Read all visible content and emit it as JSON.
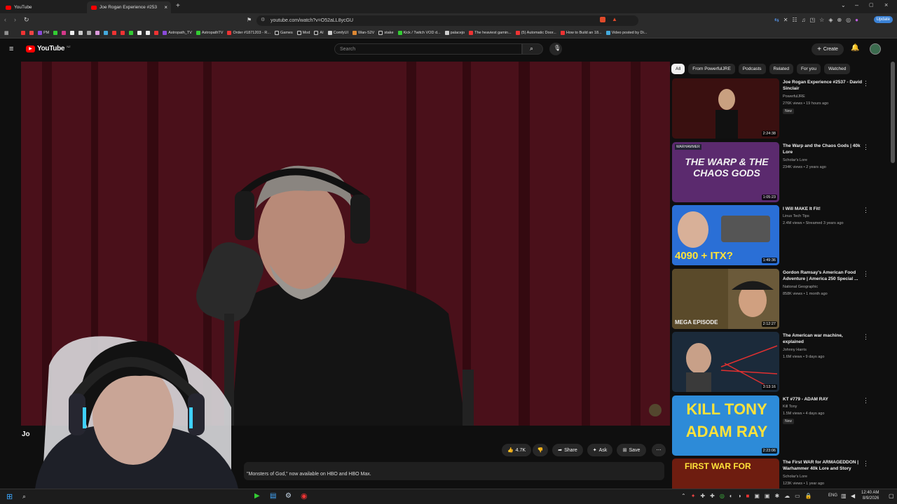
{
  "browser": {
    "tabs": [
      {
        "title": "YouTube"
      },
      {
        "title": "Joe Rogan Experience #253"
      }
    ],
    "url": "youtube.com/watch?v=O52aLL8ycGU",
    "update_label": "Update",
    "bookmarks": [
      "PM",
      "Astropath_TV",
      "AstropathTV",
      "Order #1871203 - R...",
      "Games",
      "Mod",
      "AI",
      "ComfyUI",
      "Wan-S2V",
      "stake",
      "Kick / Twitch VOD d...",
      "palacejo",
      "The heaviest gamin...",
      "(5) Automatic Door...",
      "How to Build an 18...",
      "Video posted by Di..."
    ]
  },
  "youtube": {
    "logo_text": "YouTube",
    "logo_region": "NZ",
    "search_placeholder": "Search",
    "create_label": "Create",
    "chips": [
      "All",
      "From PowerfulJRE",
      "Podcasts",
      "Related",
      "For you",
      "Watched"
    ],
    "actions": {
      "likes": "4.7K",
      "share": "Share",
      "ask": "Ask",
      "save": "Save"
    },
    "video_title_partial": "Jo",
    "description_snippet": "\"Monsters of God,\" now available on HBO and HBO Max.",
    "recommendations": [
      {
        "title": "Joe Rogan Experience #2537 - David Sinclair",
        "channel": "PowerfulJRE",
        "meta": "276K views • 19 hours ago",
        "badge": "New",
        "duration": "2:24:38",
        "thumb_color": "#2a1414"
      },
      {
        "title": "The Warp and the Chaos Gods | 40k Lore",
        "channel": "Scholar's Lore",
        "meta": "234K views • 2 years ago",
        "badge": "",
        "duration": "1:05:23",
        "thumb_color": "#5b2a6e",
        "thumb_text": "THE WARP & THE CHAOS GODS",
        "thumb_tag": "WARHAMMER"
      },
      {
        "title": "I Will MAKE It Fit!",
        "channel": "Linus Tech Tips",
        "meta": "2.4M views • Streamed 3 years ago",
        "badge": "",
        "duration": "1:49:36",
        "thumb_color": "#2a6fd6",
        "thumb_text": "4090 + ITX?"
      },
      {
        "title": "Gordon Ramsay's American Food Adventure | America 250 Special ...",
        "channel": "National Geographic",
        "meta": "858K views • 1 month ago",
        "badge": "",
        "duration": "2:12:27",
        "thumb_color": "#6b5a3a",
        "thumb_text": "MEGA EPISODE"
      },
      {
        "title": "The American war machine, explained",
        "channel": "Johnny Harris",
        "meta": "1.6M views • 9 days ago",
        "badge": "",
        "duration": "3:13:16",
        "thumb_color": "#1b2a3a"
      },
      {
        "title": "KT #779 - ADAM RAY",
        "channel": "Kill Tony",
        "meta": "1.5M views • 4 days ago",
        "badge": "New",
        "duration": "2:23:06",
        "thumb_color": "#2d8bd8",
        "thumb_text": "KILL TONY ADAM RAY"
      },
      {
        "title": "The First WAR for ARMAGEDDON | Warhammer 40k Lore and Story",
        "channel": "Scholar's Lore",
        "meta": "123K views • 1 year ago",
        "badge": "",
        "duration": "",
        "thumb_color": "#6e1d10",
        "thumb_text": "FIRST WAR FOR"
      }
    ]
  },
  "taskbar": {
    "lang": "ENG",
    "time": "12:40 AM",
    "date": "8/9/2026"
  },
  "colors": {
    "yt_red": "#ff0000",
    "bg": "#0f0f0f",
    "chip": "#272727",
    "accent_blue": "#3b82d6"
  }
}
